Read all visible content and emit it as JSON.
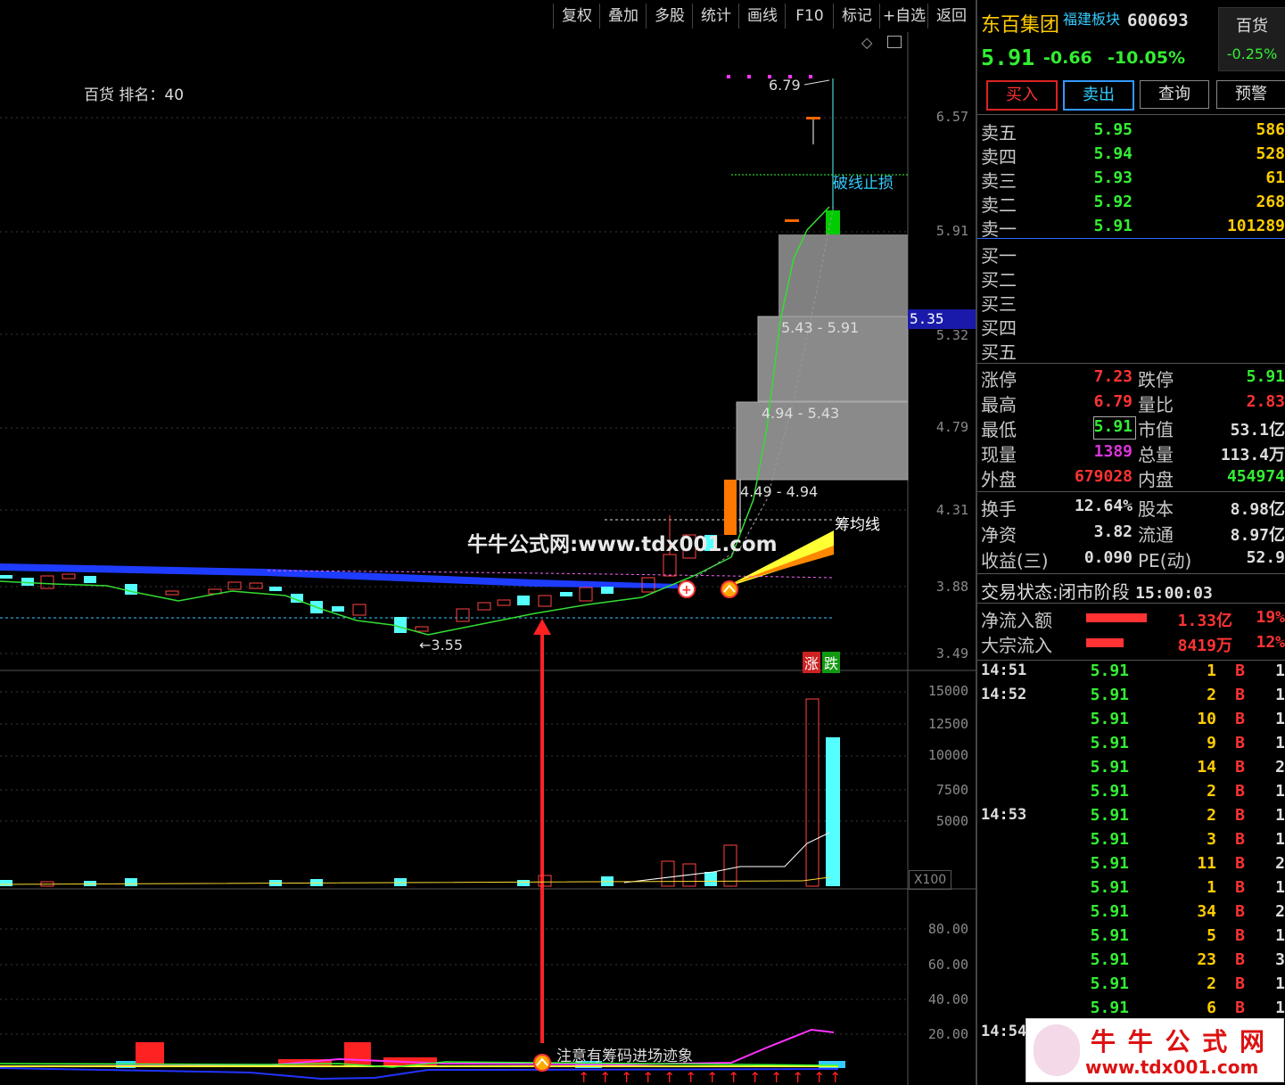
{
  "toolbar": [
    "复权",
    "叠加",
    "多股",
    "统计",
    "画线",
    "F10",
    "标记",
    "+自选",
    "返回"
  ],
  "chart": {
    "rank_label": "百货 排名：40",
    "high_mark": "6.79",
    "low_mark": "3.55",
    "stop_label": "破线止损",
    "chip_label": "筹均线",
    "watermark": "牛牛公式网:www.tdx001.com",
    "zone_labels": [
      "5.43 - 5.91",
      "4.94 - 5.43",
      "4.49 - 4.94"
    ],
    "price_ticks": [
      "6.57",
      "5.91",
      "5.32",
      "4.79",
      "4.31",
      "3.88",
      "3.49"
    ],
    "current_price_tag": "5.35",
    "rise_label": "涨",
    "fall_label": "跌",
    "vol_ticks": [
      "15000",
      "12500",
      "10000",
      "7500",
      "5000"
    ],
    "vol_unit": "X100",
    "ind_ticks": [
      "80.00",
      "60.00",
      "40.00",
      "20.00"
    ],
    "ind_note": "注意有筹码进场迹象",
    "logo_name": "牛 牛 公 式 网",
    "logo_url": "www.tdx001.com"
  },
  "stock": {
    "name": "东百集团",
    "sector": "福建板块",
    "code": "600693",
    "price": "5.91",
    "change": "-0.66",
    "change_pct": "-10.05%",
    "industry": "百货",
    "industry_pct": "-0.25%"
  },
  "actions": [
    "买入",
    "卖出",
    "查询",
    "预警"
  ],
  "asks": [
    {
      "label": "卖五",
      "price": "5.95",
      "vol": "586"
    },
    {
      "label": "卖四",
      "price": "5.94",
      "vol": "528"
    },
    {
      "label": "卖三",
      "price": "5.93",
      "vol": "61"
    },
    {
      "label": "卖二",
      "price": "5.92",
      "vol": "268"
    },
    {
      "label": "卖一",
      "price": "5.91",
      "vol": "101289"
    }
  ],
  "bids": [
    "买一",
    "买二",
    "买三",
    "买四",
    "买五"
  ],
  "stats": [
    {
      "l1": "涨停",
      "v1": "7.23",
      "l2": "跌停",
      "v2": "5.91"
    },
    {
      "l1": "最高",
      "v1": "6.79",
      "l2": "量比",
      "v2": "2.83"
    },
    {
      "l1": "最低",
      "v1": "5.91",
      "l2": "市值",
      "v2": "53.1亿"
    },
    {
      "l1": "现量",
      "v1": "1389",
      "l2": "总量",
      "v2": "113.4万"
    },
    {
      "l1": "外盘",
      "v1": "679028",
      "l2": "内盘",
      "v2": "454974"
    }
  ],
  "fundamentals": [
    {
      "l1": "换手",
      "v1": "12.64%",
      "l2": "股本",
      "v2": "8.98亿"
    },
    {
      "l1": "净资",
      "v1": "3.82",
      "l2": "流通",
      "v2": "8.97亿"
    },
    {
      "l1": "收益(三)",
      "v1": "0.090",
      "l2": "PE(动)",
      "v2": "52.9"
    }
  ],
  "trade_status": {
    "label": "交易状态:",
    "value": "闭市阶段",
    "time": "15:00:03"
  },
  "flows": [
    {
      "label": "净流入额",
      "value": "1.33亿",
      "pct": "19%",
      "level": 0.72
    },
    {
      "label": "大宗流入",
      "value": "8419万",
      "pct": "12%",
      "level": 0.45
    }
  ],
  "ticks": [
    {
      "time": "14:51",
      "price": "5.91",
      "vol": "1",
      "side": "B",
      "n": "1"
    },
    {
      "time": "14:52",
      "price": "5.91",
      "vol": "2",
      "side": "B",
      "n": "1"
    },
    {
      "time": "",
      "price": "5.91",
      "vol": "10",
      "side": "B",
      "n": "1"
    },
    {
      "time": "",
      "price": "5.91",
      "vol": "9",
      "side": "B",
      "n": "1"
    },
    {
      "time": "",
      "price": "5.91",
      "vol": "14",
      "side": "B",
      "n": "2"
    },
    {
      "time": "",
      "price": "5.91",
      "vol": "2",
      "side": "B",
      "n": "1"
    },
    {
      "time": "14:53",
      "price": "5.91",
      "vol": "2",
      "side": "B",
      "n": "1"
    },
    {
      "time": "",
      "price": "5.91",
      "vol": "3",
      "side": "B",
      "n": "1"
    },
    {
      "time": "",
      "price": "5.91",
      "vol": "11",
      "side": "B",
      "n": "2"
    },
    {
      "time": "",
      "price": "5.91",
      "vol": "1",
      "side": "B",
      "n": "1"
    },
    {
      "time": "",
      "price": "5.91",
      "vol": "34",
      "side": "B",
      "n": "2"
    },
    {
      "time": "",
      "price": "5.91",
      "vol": "5",
      "side": "B",
      "n": "1"
    },
    {
      "time": "",
      "price": "5.91",
      "vol": "23",
      "side": "B",
      "n": "3"
    },
    {
      "time": "",
      "price": "5.91",
      "vol": "2",
      "side": "B",
      "n": "1"
    },
    {
      "time": "",
      "price": "5.91",
      "vol": "6",
      "side": "B",
      "n": "1"
    },
    {
      "time": "14:54",
      "price": "",
      "vol": "",
      "side": "",
      "n": ""
    }
  ]
}
